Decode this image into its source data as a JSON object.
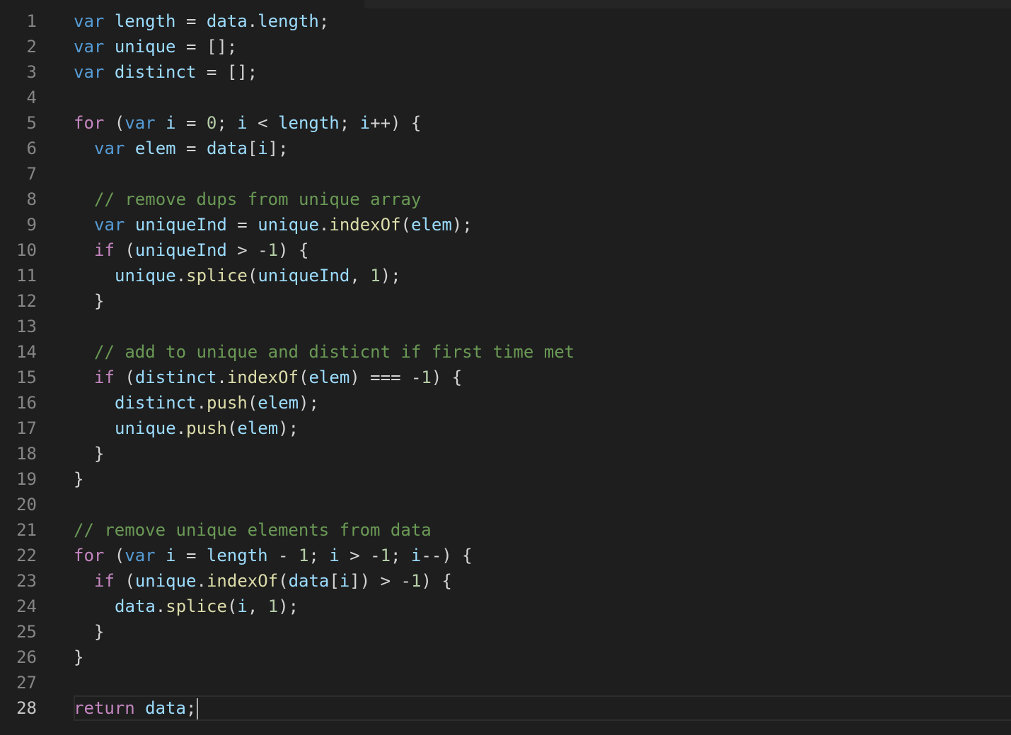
{
  "editor": {
    "language": "javascript",
    "current_line": 28,
    "colors": {
      "background": "#1e1e1e",
      "line_number": "#858585",
      "line_number_active": "#c6c6c6",
      "keyword": "#569cd6",
      "control": "#c586c0",
      "variable": "#9cdcfe",
      "function": "#dcdcaa",
      "number": "#b5cea8",
      "comment": "#6a9955",
      "punctuation": "#d4d4d4"
    },
    "lines": [
      {
        "number": "1",
        "indent": 0,
        "tokens": [
          [
            "kw",
            "var"
          ],
          [
            "pun",
            " "
          ],
          [
            "var",
            "length"
          ],
          [
            "pun",
            " = "
          ],
          [
            "var",
            "data"
          ],
          [
            "pun",
            "."
          ],
          [
            "var",
            "length"
          ],
          [
            "pun",
            ";"
          ]
        ]
      },
      {
        "number": "2",
        "indent": 0,
        "tokens": [
          [
            "kw",
            "var"
          ],
          [
            "pun",
            " "
          ],
          [
            "var",
            "unique"
          ],
          [
            "pun",
            " = [];"
          ]
        ]
      },
      {
        "number": "3",
        "indent": 0,
        "tokens": [
          [
            "kw",
            "var"
          ],
          [
            "pun",
            " "
          ],
          [
            "var",
            "distinct"
          ],
          [
            "pun",
            " = [];"
          ]
        ]
      },
      {
        "number": "4",
        "indent": 0,
        "tokens": []
      },
      {
        "number": "5",
        "indent": 0,
        "tokens": [
          [
            "ctl",
            "for"
          ],
          [
            "pun",
            " ("
          ],
          [
            "kw",
            "var"
          ],
          [
            "pun",
            " "
          ],
          [
            "var",
            "i"
          ],
          [
            "pun",
            " = "
          ],
          [
            "num",
            "0"
          ],
          [
            "pun",
            "; "
          ],
          [
            "var",
            "i"
          ],
          [
            "pun",
            " < "
          ],
          [
            "var",
            "length"
          ],
          [
            "pun",
            "; "
          ],
          [
            "var",
            "i"
          ],
          [
            "pun",
            "++) {"
          ]
        ]
      },
      {
        "number": "6",
        "indent": 1,
        "tokens": [
          [
            "kw",
            "var"
          ],
          [
            "pun",
            " "
          ],
          [
            "var",
            "elem"
          ],
          [
            "pun",
            " = "
          ],
          [
            "var",
            "data"
          ],
          [
            "pun",
            "["
          ],
          [
            "var",
            "i"
          ],
          [
            "pun",
            "];"
          ]
        ]
      },
      {
        "number": "7",
        "indent": 0,
        "tokens": []
      },
      {
        "number": "8",
        "indent": 1,
        "tokens": [
          [
            "cmt",
            "// remove dups from unique array"
          ]
        ]
      },
      {
        "number": "9",
        "indent": 1,
        "tokens": [
          [
            "kw",
            "var"
          ],
          [
            "pun",
            " "
          ],
          [
            "var",
            "uniqueInd"
          ],
          [
            "pun",
            " = "
          ],
          [
            "var",
            "unique"
          ],
          [
            "pun",
            "."
          ],
          [
            "fn",
            "indexOf"
          ],
          [
            "pun",
            "("
          ],
          [
            "var",
            "elem"
          ],
          [
            "pun",
            ");"
          ]
        ]
      },
      {
        "number": "10",
        "indent": 1,
        "tokens": [
          [
            "ctl",
            "if"
          ],
          [
            "pun",
            " ("
          ],
          [
            "var",
            "uniqueInd"
          ],
          [
            "pun",
            " > -"
          ],
          [
            "num",
            "1"
          ],
          [
            "pun",
            ") {"
          ]
        ]
      },
      {
        "number": "11",
        "indent": 2,
        "tokens": [
          [
            "var",
            "unique"
          ],
          [
            "pun",
            "."
          ],
          [
            "fn",
            "splice"
          ],
          [
            "pun",
            "("
          ],
          [
            "var",
            "uniqueInd"
          ],
          [
            "pun",
            ", "
          ],
          [
            "num",
            "1"
          ],
          [
            "pun",
            ");"
          ]
        ]
      },
      {
        "number": "12",
        "indent": 1,
        "tokens": [
          [
            "pun",
            "}"
          ]
        ]
      },
      {
        "number": "13",
        "indent": 0,
        "tokens": []
      },
      {
        "number": "14",
        "indent": 1,
        "tokens": [
          [
            "cmt",
            "// add to unique and disticnt if first time met"
          ]
        ]
      },
      {
        "number": "15",
        "indent": 1,
        "tokens": [
          [
            "ctl",
            "if"
          ],
          [
            "pun",
            " ("
          ],
          [
            "var",
            "distinct"
          ],
          [
            "pun",
            "."
          ],
          [
            "fn",
            "indexOf"
          ],
          [
            "pun",
            "("
          ],
          [
            "var",
            "elem"
          ],
          [
            "pun",
            ") === -"
          ],
          [
            "num",
            "1"
          ],
          [
            "pun",
            ") {"
          ]
        ]
      },
      {
        "number": "16",
        "indent": 2,
        "tokens": [
          [
            "var",
            "distinct"
          ],
          [
            "pun",
            "."
          ],
          [
            "fn",
            "push"
          ],
          [
            "pun",
            "("
          ],
          [
            "var",
            "elem"
          ],
          [
            "pun",
            ");"
          ]
        ]
      },
      {
        "number": "17",
        "indent": 2,
        "tokens": [
          [
            "var",
            "unique"
          ],
          [
            "pun",
            "."
          ],
          [
            "fn",
            "push"
          ],
          [
            "pun",
            "("
          ],
          [
            "var",
            "elem"
          ],
          [
            "pun",
            ");"
          ]
        ]
      },
      {
        "number": "18",
        "indent": 1,
        "tokens": [
          [
            "pun",
            "}"
          ]
        ]
      },
      {
        "number": "19",
        "indent": 0,
        "tokens": [
          [
            "pun",
            "}"
          ]
        ]
      },
      {
        "number": "20",
        "indent": 0,
        "tokens": []
      },
      {
        "number": "21",
        "indent": 0,
        "tokens": [
          [
            "cmt",
            "// remove unique elements from data"
          ]
        ]
      },
      {
        "number": "22",
        "indent": 0,
        "tokens": [
          [
            "ctl",
            "for"
          ],
          [
            "pun",
            " ("
          ],
          [
            "kw",
            "var"
          ],
          [
            "pun",
            " "
          ],
          [
            "var",
            "i"
          ],
          [
            "pun",
            " = "
          ],
          [
            "var",
            "length"
          ],
          [
            "pun",
            " - "
          ],
          [
            "num",
            "1"
          ],
          [
            "pun",
            "; "
          ],
          [
            "var",
            "i"
          ],
          [
            "pun",
            " > -"
          ],
          [
            "num",
            "1"
          ],
          [
            "pun",
            "; "
          ],
          [
            "var",
            "i"
          ],
          [
            "pun",
            "--) {"
          ]
        ]
      },
      {
        "number": "23",
        "indent": 1,
        "tokens": [
          [
            "ctl",
            "if"
          ],
          [
            "pun",
            " ("
          ],
          [
            "var",
            "unique"
          ],
          [
            "pun",
            "."
          ],
          [
            "fn",
            "indexOf"
          ],
          [
            "pun",
            "("
          ],
          [
            "var",
            "data"
          ],
          [
            "pun",
            "["
          ],
          [
            "var",
            "i"
          ],
          [
            "pun",
            "]) > -"
          ],
          [
            "num",
            "1"
          ],
          [
            "pun",
            ") {"
          ]
        ]
      },
      {
        "number": "24",
        "indent": 2,
        "tokens": [
          [
            "var",
            "data"
          ],
          [
            "pun",
            "."
          ],
          [
            "fn",
            "splice"
          ],
          [
            "pun",
            "("
          ],
          [
            "var",
            "i"
          ],
          [
            "pun",
            ", "
          ],
          [
            "num",
            "1"
          ],
          [
            "pun",
            ");"
          ]
        ]
      },
      {
        "number": "25",
        "indent": 1,
        "tokens": [
          [
            "pun",
            "}"
          ]
        ]
      },
      {
        "number": "26",
        "indent": 0,
        "tokens": [
          [
            "pun",
            "}"
          ]
        ]
      },
      {
        "number": "27",
        "indent": 0,
        "tokens": []
      },
      {
        "number": "28",
        "indent": 0,
        "tokens": [
          [
            "ctl",
            "return"
          ],
          [
            "pun",
            " "
          ],
          [
            "var",
            "data"
          ],
          [
            "pun",
            ";"
          ]
        ]
      }
    ]
  }
}
